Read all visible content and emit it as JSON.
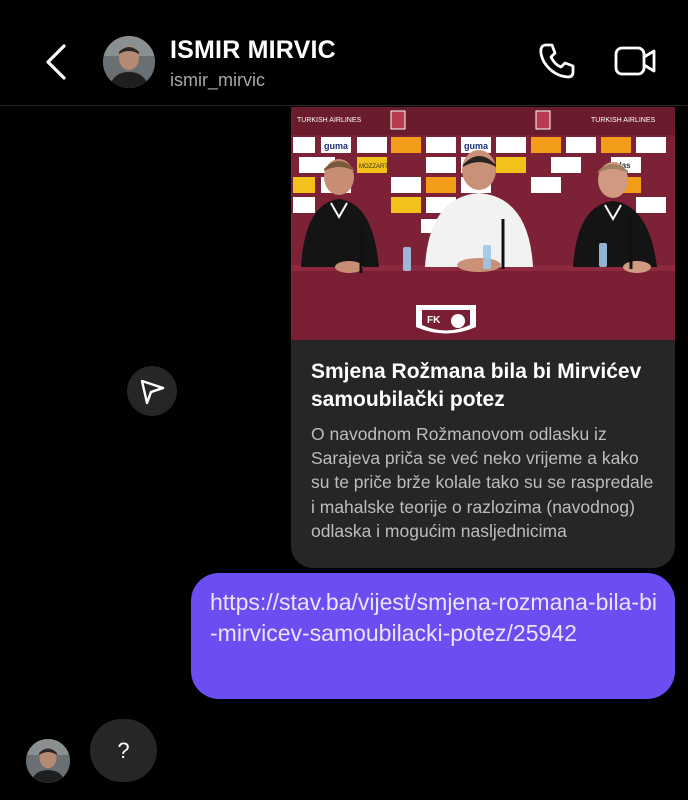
{
  "header": {
    "name": "ISMIR MIRVIC",
    "handle": "ismir_mirvic",
    "back_icon": "chevron-left-icon",
    "call_icon": "phone-icon",
    "video_icon": "video-camera-icon"
  },
  "link_card": {
    "title": "Smjena Rožmana bila bi Mirvićev samoubilački potez",
    "description": "O navodnom Rožmanovom odlasku iz Sarajeva priča se već neko vrijeme a kako su te priče brže kolale tako su se raspredale i mahalske teorije o razlozima (navodnog) odlaska i mogućim nasljednicima",
    "image_icon": "press-conference-photo",
    "image_texts": {
      "sponsor_airline": "TURKISH AIRLINES",
      "sponsor_guma": "guma",
      "sponsor_mozzart": "MOZZART",
      "sponsor_klas": "klas",
      "club_mark": "FK"
    }
  },
  "share_icon": "paper-plane-icon",
  "outgoing_message": {
    "text": "https://stav.ba/vijest/smjena-rozmana-bila-bi-mirvicev-samoubilacki-potez/25942"
  },
  "incoming_message": {
    "text": "?"
  },
  "colors": {
    "background": "#000000",
    "bubble_outgoing": "#6b4df2",
    "bubble_incoming": "#262626",
    "card_bg": "#262626"
  }
}
